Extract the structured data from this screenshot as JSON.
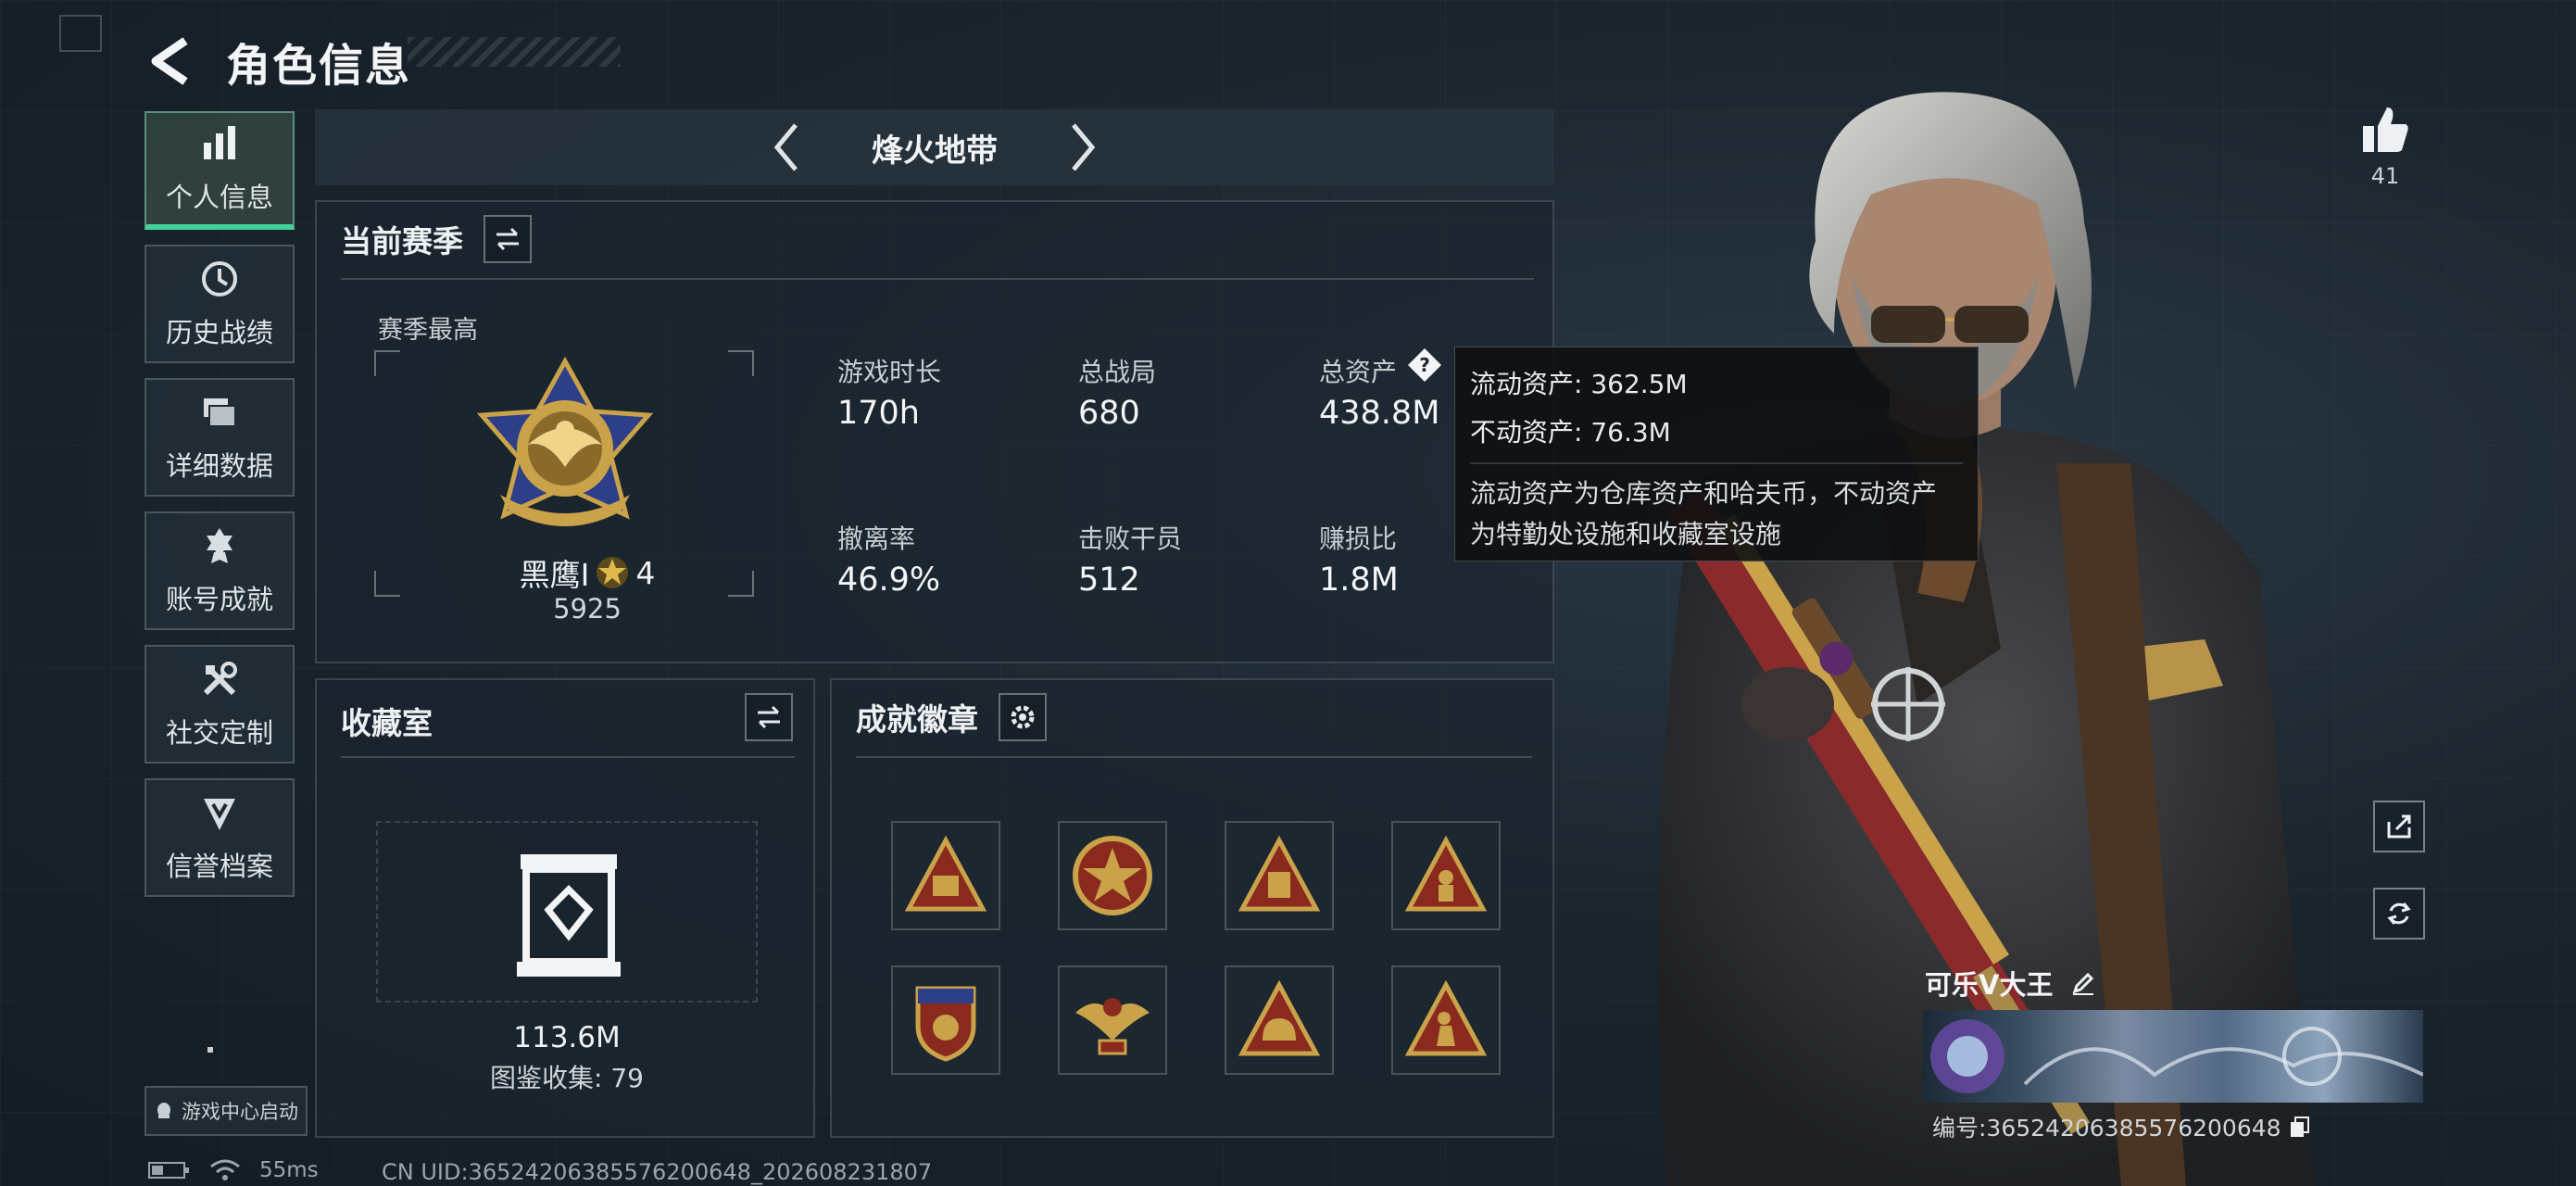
{
  "header": {
    "title": "角色信息"
  },
  "sidebar": {
    "items": [
      {
        "label": "个人信息",
        "icon": "bar-chart-icon",
        "active": true
      },
      {
        "label": "历史战绩",
        "icon": "clock-icon",
        "active": false
      },
      {
        "label": "详细数据",
        "icon": "folder-icon",
        "active": false
      },
      {
        "label": "账号成就",
        "icon": "medal-icon",
        "active": false
      },
      {
        "label": "社交定制",
        "icon": "tools-icon",
        "active": false
      },
      {
        "label": "信誉档案",
        "icon": "shield-icon",
        "active": false
      }
    ],
    "game_center": "游戏中心启动"
  },
  "mode": {
    "title": "烽火地带"
  },
  "season": {
    "title": "当前赛季",
    "best_label": "赛季最高",
    "rank_name": "黑鹰I",
    "rank_stars": "4",
    "rank_score": "5925",
    "stats": [
      {
        "label": "游戏时长",
        "value": "170h"
      },
      {
        "label": "总战局",
        "value": "680"
      },
      {
        "label": "总资产",
        "value": "438.8M"
      },
      {
        "label": "撤离率",
        "value": "46.9%"
      },
      {
        "label": "击败干员",
        "value": "512"
      },
      {
        "label": "赚损比",
        "value": "1.8M"
      }
    ]
  },
  "tooltip": {
    "line1": "流动资产: 362.5M",
    "line2": "不动资产: 76.3M",
    "desc1": "流动资产为仓库资产和哈夫币，不动资产",
    "desc2": "为特勤处设施和收藏室设施"
  },
  "collection": {
    "title": "收藏室",
    "value": "113.6M",
    "catalog": "图鉴收集: 79"
  },
  "badges": {
    "title": "成就徽章",
    "items": [
      "badge-triangle-sb",
      "badge-star-round",
      "badge-triangle-crate",
      "badge-triangle-figure",
      "badge-shield-stars",
      "badge-eagle-wings",
      "badge-triangle-helmet",
      "badge-triangle-soldier"
    ]
  },
  "social": {
    "like_count": "41"
  },
  "player": {
    "name": "可乐V大王",
    "id": "编号:3652420638557620064​8"
  },
  "status": {
    "ping": "55ms",
    "uid": "CN UID:36524206385576200648_202608231807"
  },
  "colors": {
    "accent": "#3fd39a",
    "panel": "#1c262f",
    "gold": "#c9a24a"
  }
}
